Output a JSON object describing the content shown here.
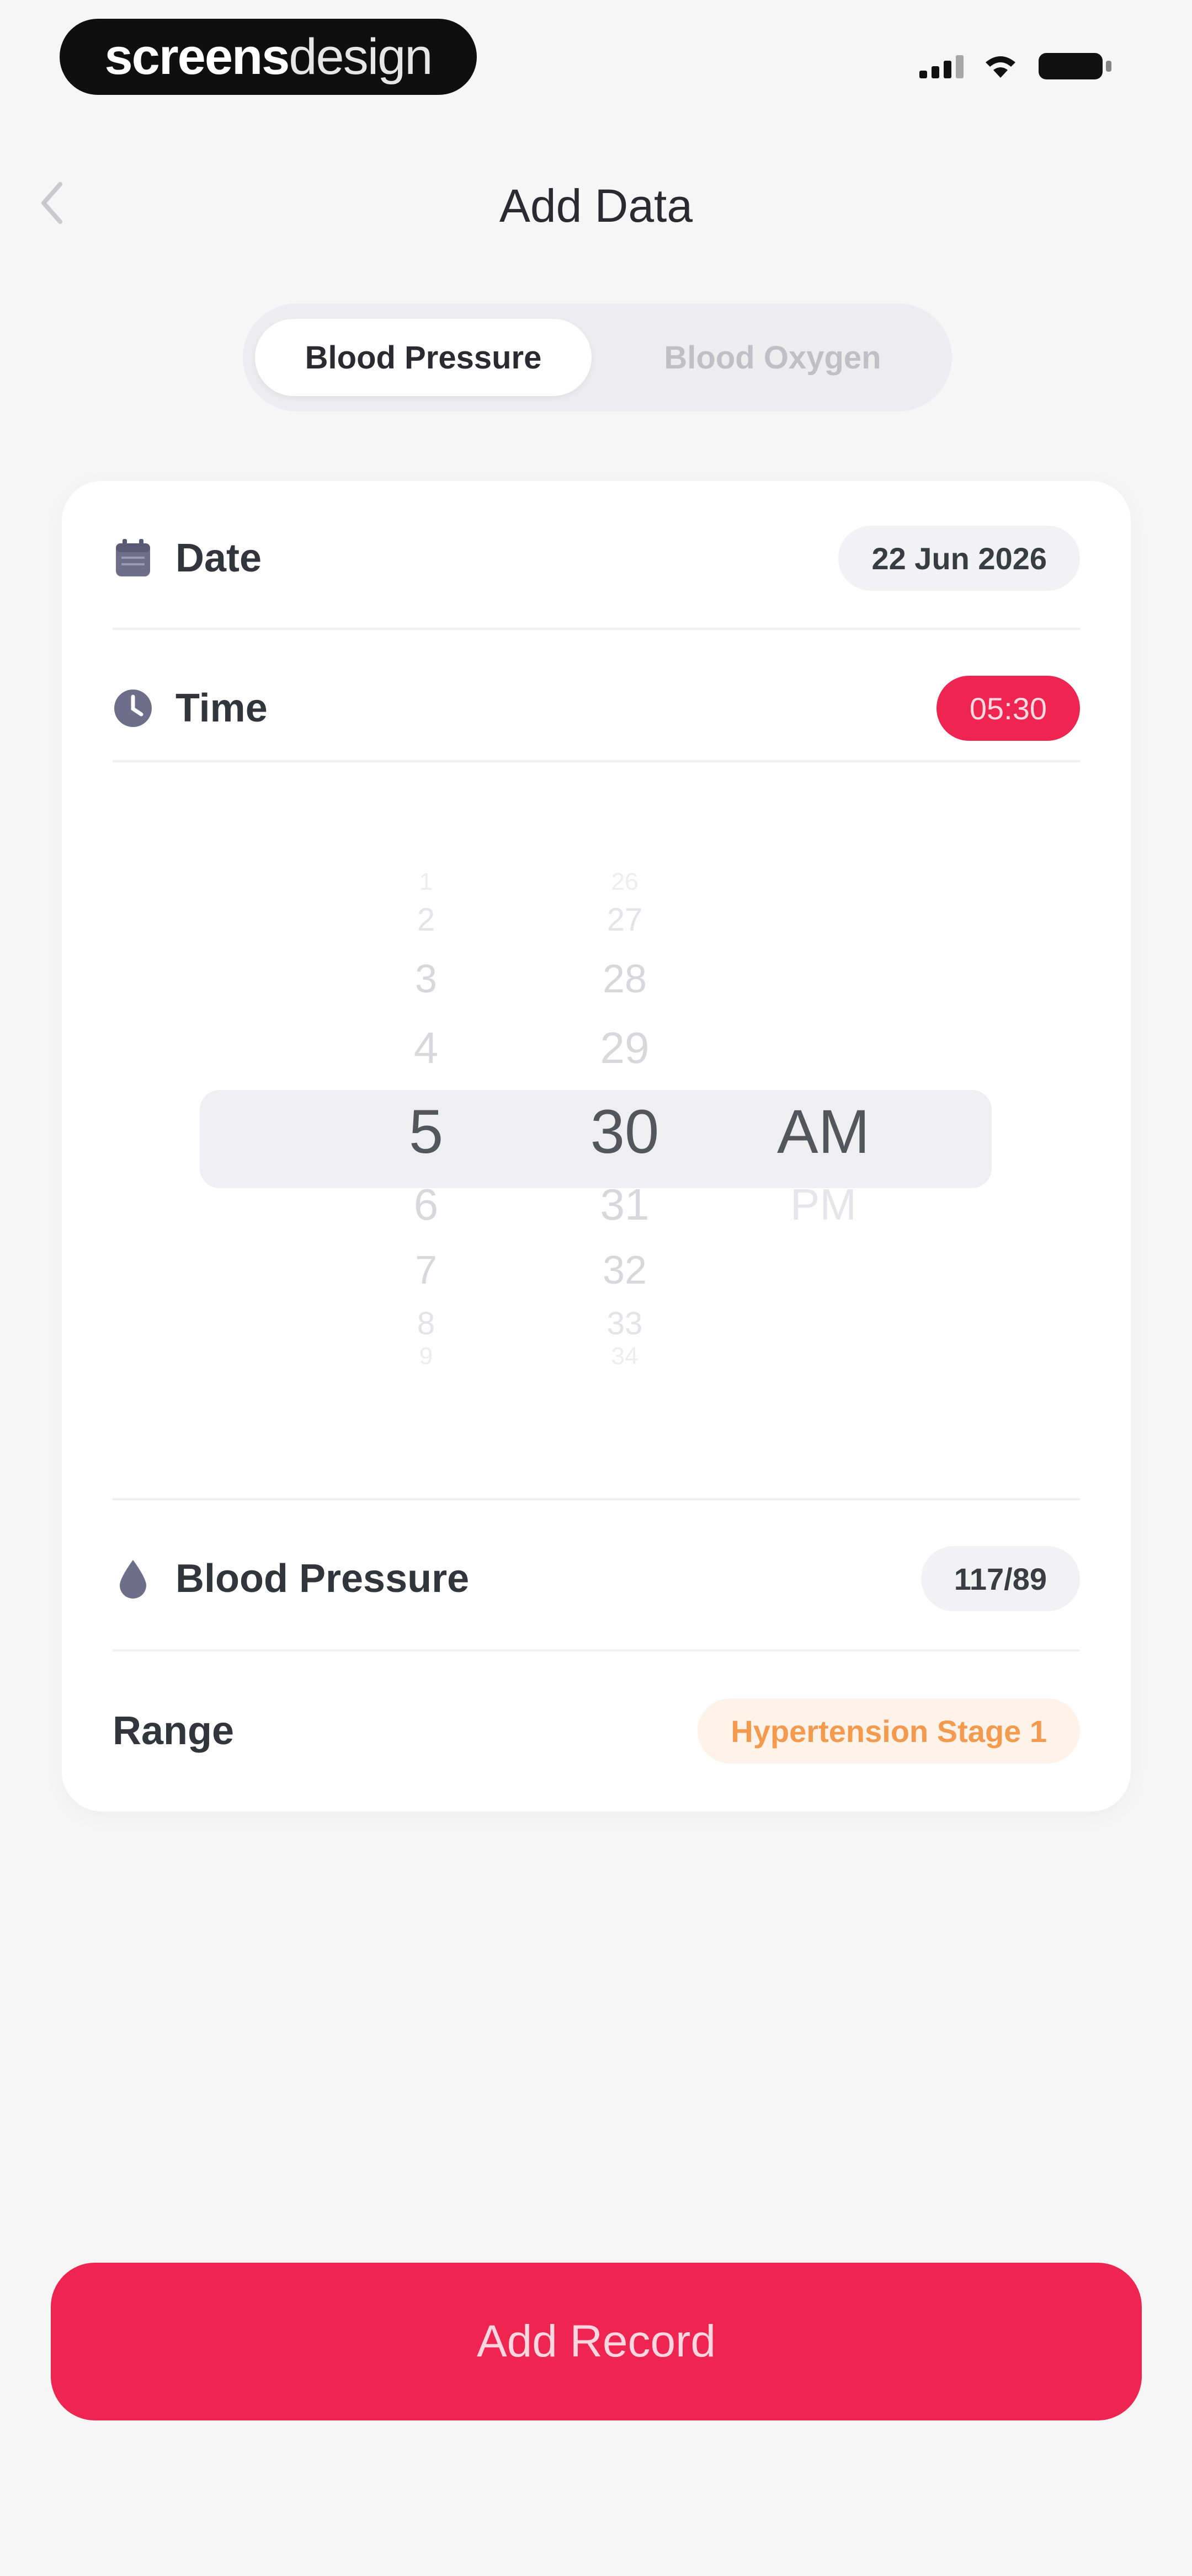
{
  "status_bar": {
    "logo_bold": "screens",
    "logo_light": "design"
  },
  "header": {
    "title": "Add Data"
  },
  "segmented": {
    "active_tab": "Blood Pressure",
    "inactive_tab": "Blood Oxygen"
  },
  "date_row": {
    "label": "Date",
    "value": "22 Jun 2026"
  },
  "time_row": {
    "label": "Time",
    "value": "05:30"
  },
  "picker": {
    "hours_above": [
      "1",
      "2",
      "3",
      "4"
    ],
    "hour_selected": "5",
    "hours_below": [
      "6",
      "7",
      "8",
      "9"
    ],
    "minutes_above": [
      "26",
      "27",
      "28",
      "29"
    ],
    "minute_selected": "30",
    "minutes_below": [
      "31",
      "32",
      "33",
      "34"
    ],
    "period_selected": "AM",
    "period_below": "PM"
  },
  "bp_row": {
    "label": "Blood Pressure",
    "value": "117/89"
  },
  "range_row": {
    "label": "Range",
    "value": "Hypertension Stage 1"
  },
  "footer": {
    "add_button": "Add Record"
  },
  "colors": {
    "accent": "#EE2451",
    "warning": "#F39A4F"
  },
  "icons": [
    "back-chevron-icon",
    "calendar-icon",
    "clock-icon",
    "blood-drop-icon",
    "signal-icon",
    "wifi-icon",
    "battery-icon"
  ]
}
